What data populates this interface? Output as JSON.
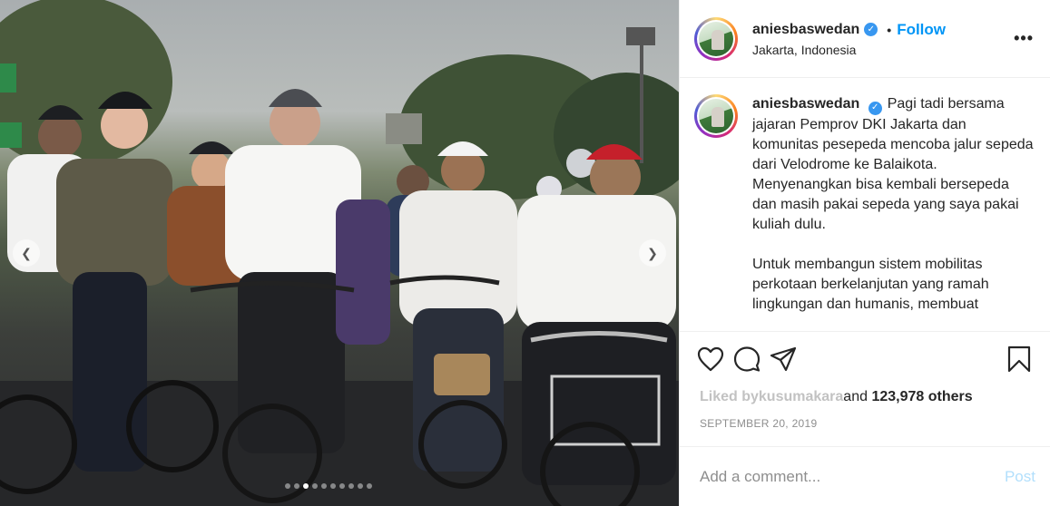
{
  "post": {
    "username": "aniesbaswedan",
    "location": "Jakarta, Indonesia",
    "follow_label": "Follow",
    "separator": "•",
    "more_icon": "•••",
    "caption_paragraphs": [
      "Pagi tadi bersama jajaran Pemprov DKI Jakarta dan komunitas pesepeda mencoba jalur sepeda dari Velodrome ke Balaikota. Menyenangkan bisa kembali bersepeda dan masih pakai sepeda yang saya pakai kuliah dulu.",
      "Untuk membangun sistem mobilitas perkotaan berkelanjutan yang ramah lingkungan dan humanis, membuat"
    ],
    "likes_prefix": "Liked by ",
    "likes_blurred_name": "kusumakara",
    "likes_suffix": " and ",
    "likes_count": "123,978 others",
    "date": "SEPTEMBER 20, 2019",
    "comment_placeholder": "Add a comment...",
    "post_button": "Post",
    "carousel": {
      "total": 10,
      "active": 2
    },
    "icons": [
      "heart-icon",
      "comment-icon",
      "share-icon",
      "bookmark-icon",
      "verified-icon",
      "chevron-left-icon",
      "chevron-right-icon"
    ],
    "colors": {
      "accent": "#0095f6",
      "verified": "#3897f0",
      "post_disabled": "#b2dffc"
    }
  }
}
